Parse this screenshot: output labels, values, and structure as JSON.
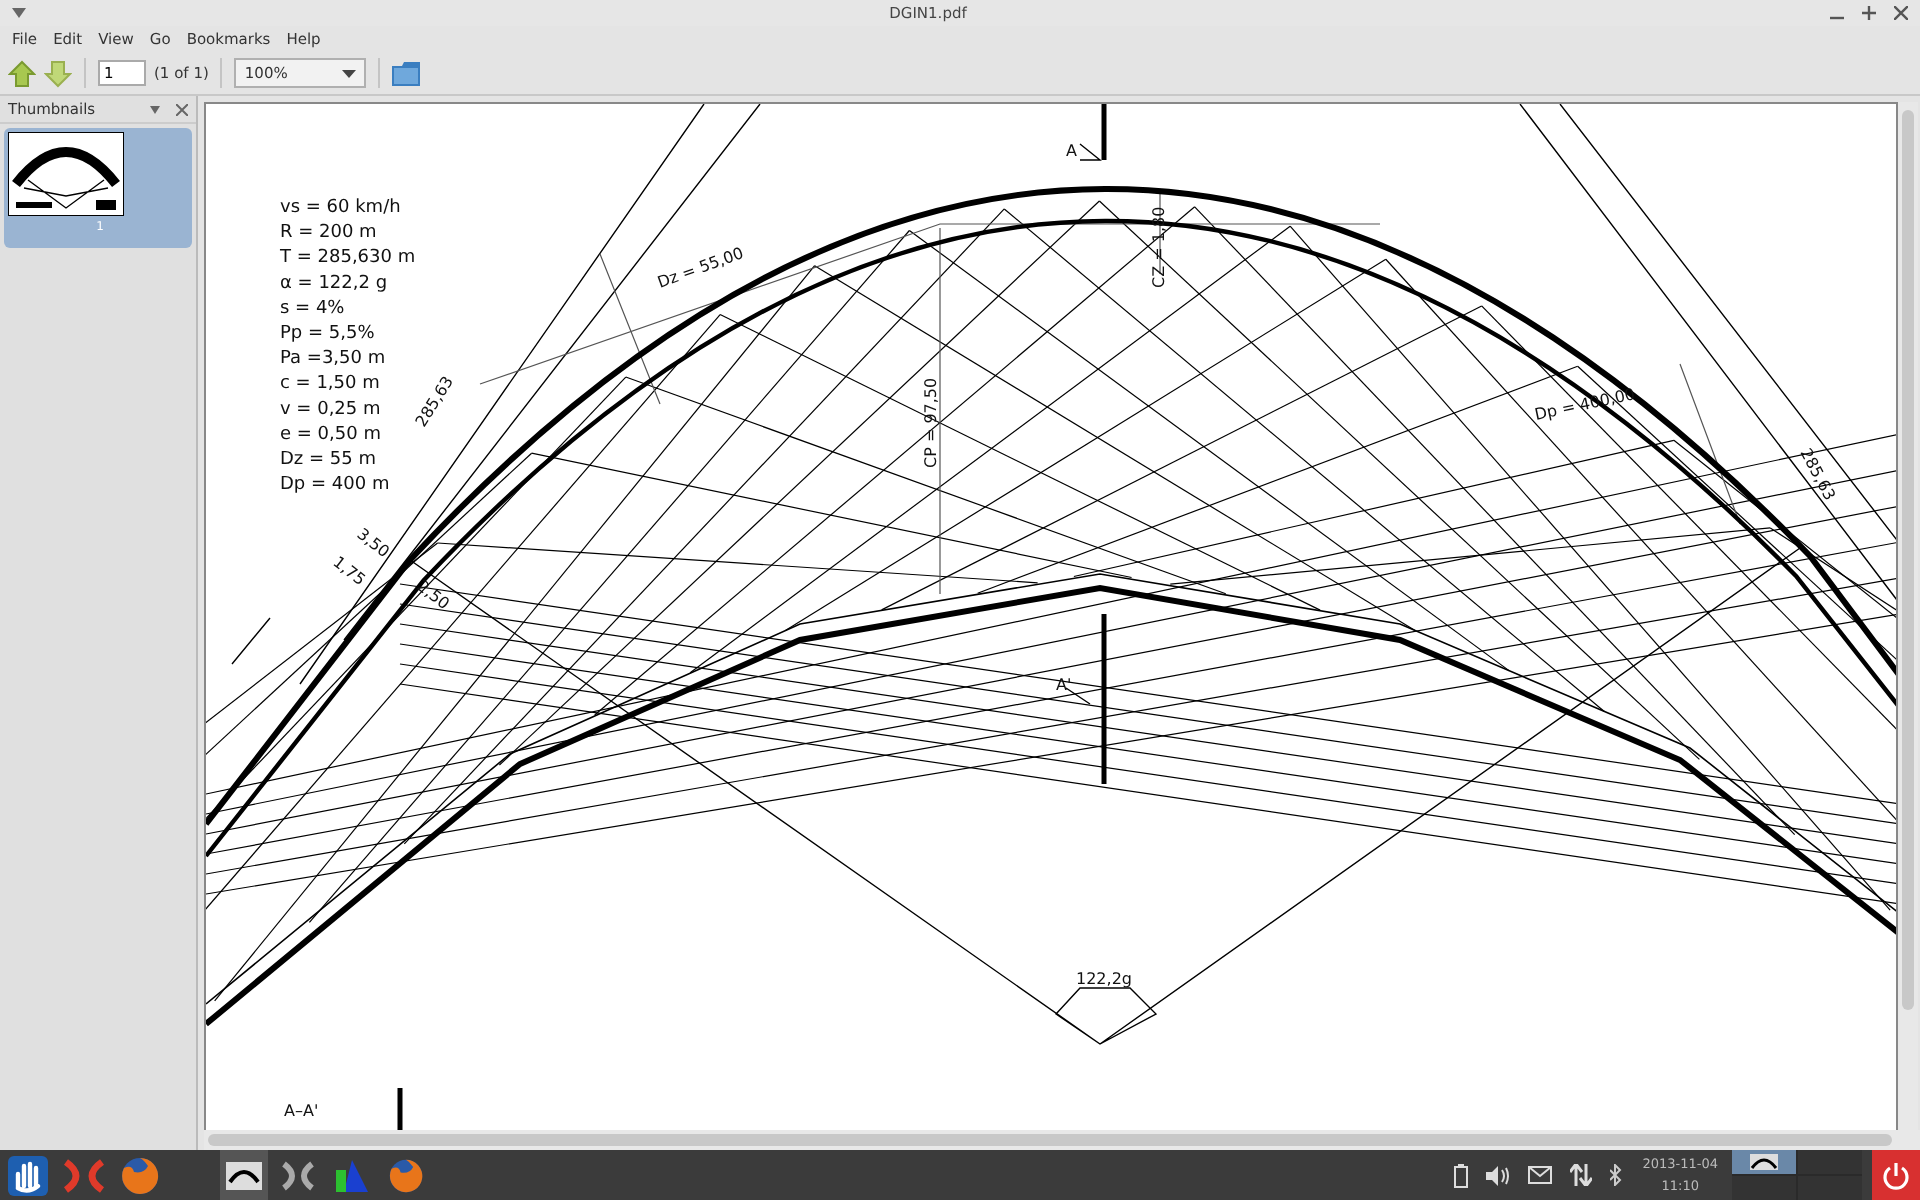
{
  "window": {
    "title": "DGIN1.pdf"
  },
  "menu": [
    "File",
    "Edit",
    "View",
    "Go",
    "Bookmarks",
    "Help"
  ],
  "toolbar": {
    "page": "1",
    "page_count": "(1 of 1)",
    "zoom": "100%"
  },
  "sidebar": {
    "title": "Thumbnails",
    "thumbnails": [
      {
        "label": "1",
        "selected": true
      }
    ]
  },
  "drawing": {
    "parameters": [
      "vs = 60 km/h",
      "R = 200 m",
      "T = 285,630 m",
      "α = 122,2 g",
      "s = 4%",
      "Pp = 5,5%",
      "Pa =3,50 m",
      "c = 1,50 m",
      "v = 0,25 m",
      "e = 0,50 m",
      "Dz = 55 m",
      "Dp = 400 m"
    ],
    "labels": [
      "Dz = 55,00",
      "CZ = 1,80",
      "CP = 97,50",
      "285,63",
      "3,50",
      "1,75",
      "2,50",
      "Dp = 400,00",
      "285,63",
      "A",
      "A'",
      "122,2g",
      "A–A'"
    ]
  },
  "taskbar": {
    "date": "2013-11-04",
    "time": "11:10",
    "workspaces": [
      {
        "selected": true
      },
      {
        "selected": false
      },
      {
        "selected": false
      },
      {
        "selected": false
      }
    ]
  }
}
